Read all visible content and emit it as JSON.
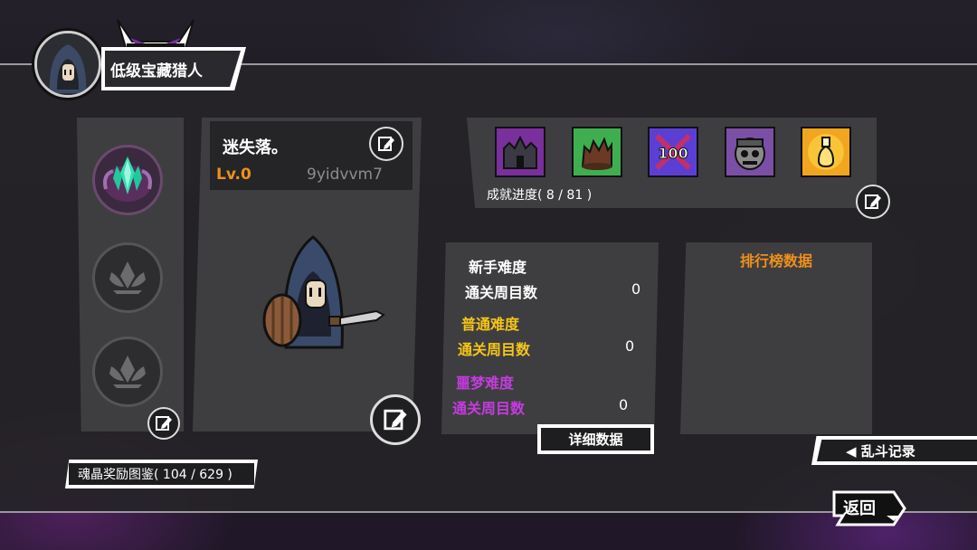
{
  "header": {
    "title": "低级宝藏猎人"
  },
  "character": {
    "name": "迷失落。",
    "level": "Lv.0",
    "id": "9yidvvm7"
  },
  "achievements": {
    "progress_label": "成就进度( 8 / 81 )",
    "icons": [
      "dark-castle-icon",
      "broken-barrel-icon",
      "hundred-badge-icon",
      "zombie-head-icon",
      "golden-potion-icon"
    ]
  },
  "stats": {
    "difficulties": [
      {
        "name": "新手难度",
        "metric_label": "通关周目数",
        "value": "0",
        "color": "#ffffff"
      },
      {
        "name": "普通难度",
        "metric_label": "通关周目数",
        "value": "0",
        "color": "#f5c518"
      },
      {
        "name": "噩梦难度",
        "metric_label": "通关周目数",
        "value": "0",
        "color": "#c43ce0"
      }
    ],
    "detail_button": "详细数据"
  },
  "leaderboard": {
    "title": "排行榜数据"
  },
  "brawl_button": "◀ 乱斗记录",
  "soul_crystal": "魂晶奖励图鉴( 104 / 629 )",
  "back_button": "返回",
  "colors": {
    "accent_orange": "#f0901c",
    "accent_yellow": "#f5c518",
    "accent_purple": "#c43ce0"
  }
}
